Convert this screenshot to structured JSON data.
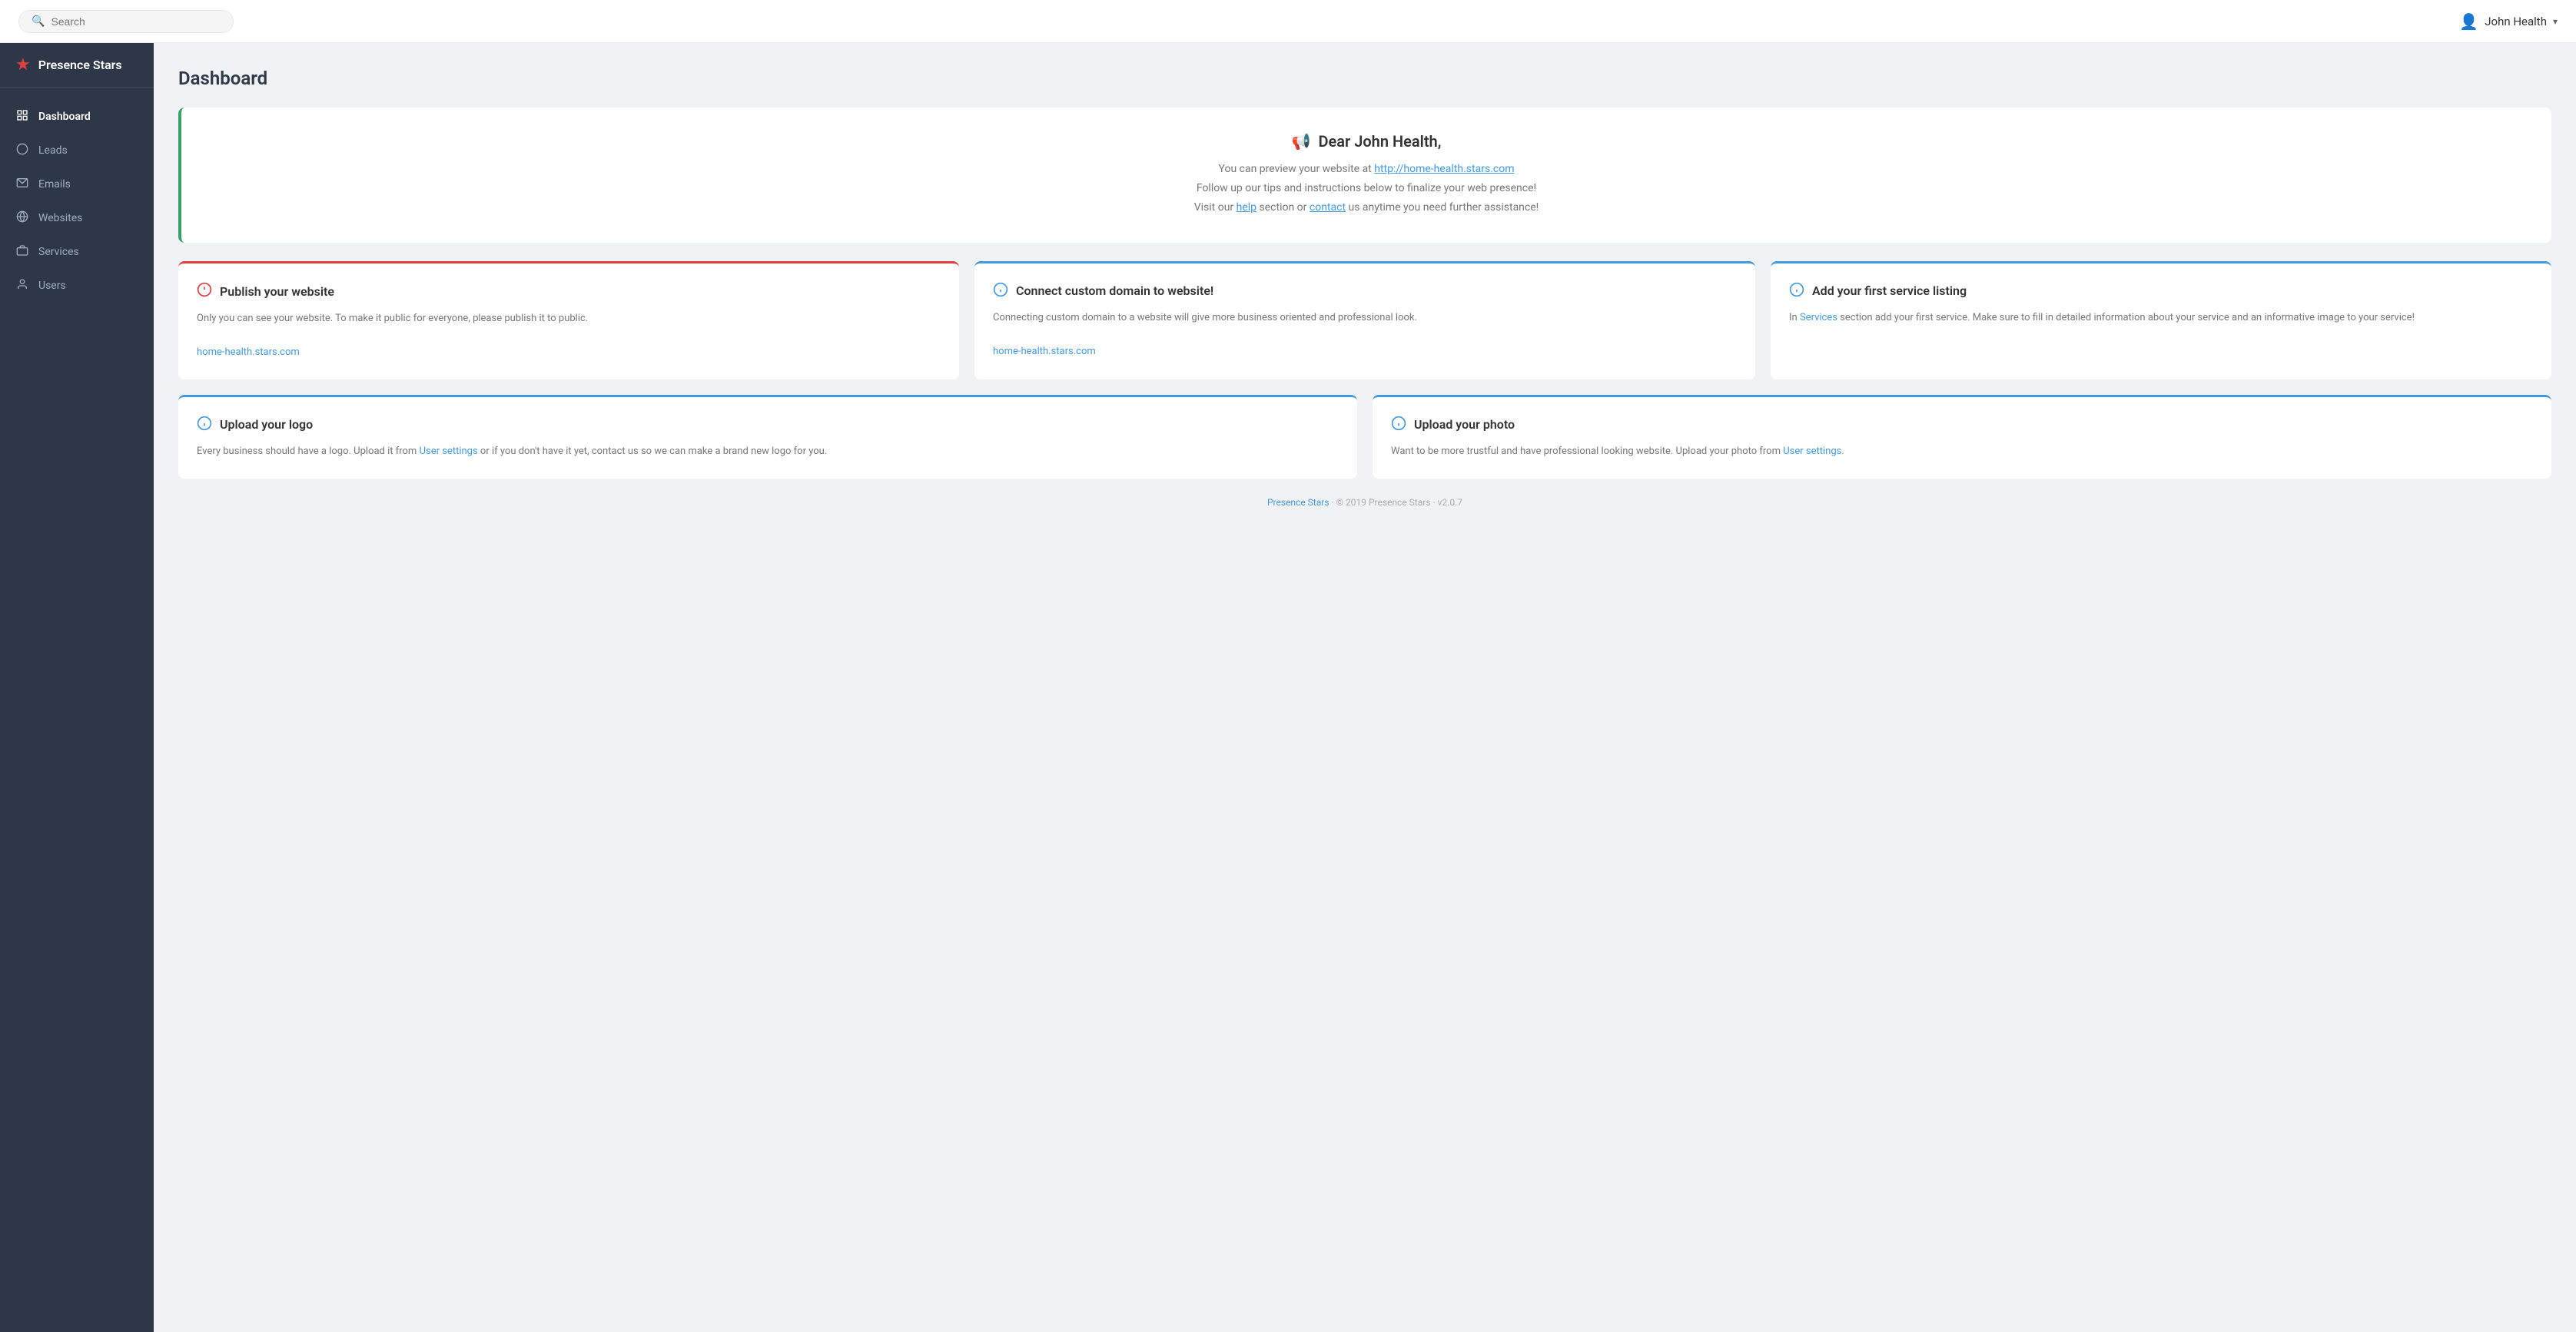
{
  "brand": {
    "name": "Presence Stars",
    "star": "★"
  },
  "header": {
    "search_placeholder": "Search",
    "user_name": "John Health"
  },
  "sidebar": {
    "items": [
      {
        "id": "dashboard",
        "label": "Dashboard",
        "active": true,
        "icon": "grid"
      },
      {
        "id": "leads",
        "label": "Leads",
        "active": false,
        "icon": "circle"
      },
      {
        "id": "emails",
        "label": "Emails",
        "active": false,
        "icon": "mail"
      },
      {
        "id": "websites",
        "label": "Websites",
        "active": false,
        "icon": "globe"
      },
      {
        "id": "services",
        "label": "Services",
        "active": false,
        "icon": "briefcase"
      },
      {
        "id": "users",
        "label": "Users",
        "active": false,
        "icon": "user"
      }
    ]
  },
  "page": {
    "title": "Dashboard"
  },
  "welcome": {
    "icon": "📢",
    "title": "Dear John Health,",
    "line1": "You can preview your website at ",
    "website_url": "http://home-health.stars.com",
    "line2": "Follow up our tips and instructions below to finalize your web presence!",
    "line3": "Visit our ",
    "help_text": "help",
    "line3b": " section or ",
    "contact_text": "contact",
    "line3c": " us anytime you need further assistance!"
  },
  "cards_row1": [
    {
      "id": "publish",
      "icon_type": "error",
      "title": "Publish your website",
      "body": "Only you can see your website. To make it public for everyone, please publish it to public.",
      "link_text": "home-health.stars.com",
      "link_href": "#",
      "border": "red"
    },
    {
      "id": "domain",
      "icon_type": "info",
      "title": "Connect custom domain to website!",
      "body": "Connecting custom domain to a website will give more business oriented and professional look.",
      "link_text": "home-health.stars.com",
      "link_href": "#",
      "border": "blue"
    },
    {
      "id": "service",
      "icon_type": "info",
      "title": "Add your first service listing",
      "body_prefix": "In ",
      "body_link_text": "Services",
      "body_suffix": " section add your first service. Make sure to fill in detailed information about your service and an informative image to your service!",
      "border": "blue"
    }
  ],
  "cards_row2": [
    {
      "id": "logo",
      "icon_type": "info",
      "title": "Upload your logo",
      "body_prefix": "Every business should have a logo. Upload it from ",
      "body_link_text": "User settings",
      "body_suffix": " or if you don't have it yet, contact us so we can make a brand new logo for you.",
      "border": "blue"
    },
    {
      "id": "photo",
      "icon_type": "info",
      "title": "Upload your photo",
      "body_prefix": "Want to be more trustful and have professional looking website. Upload your photo from ",
      "body_link_text": "User settings.",
      "body_suffix": "",
      "border": "blue"
    }
  ],
  "footer": {
    "brand_link": "Presence Stars",
    "copyright": "© 2019 Presence Stars",
    "version": "v2.0.7"
  }
}
